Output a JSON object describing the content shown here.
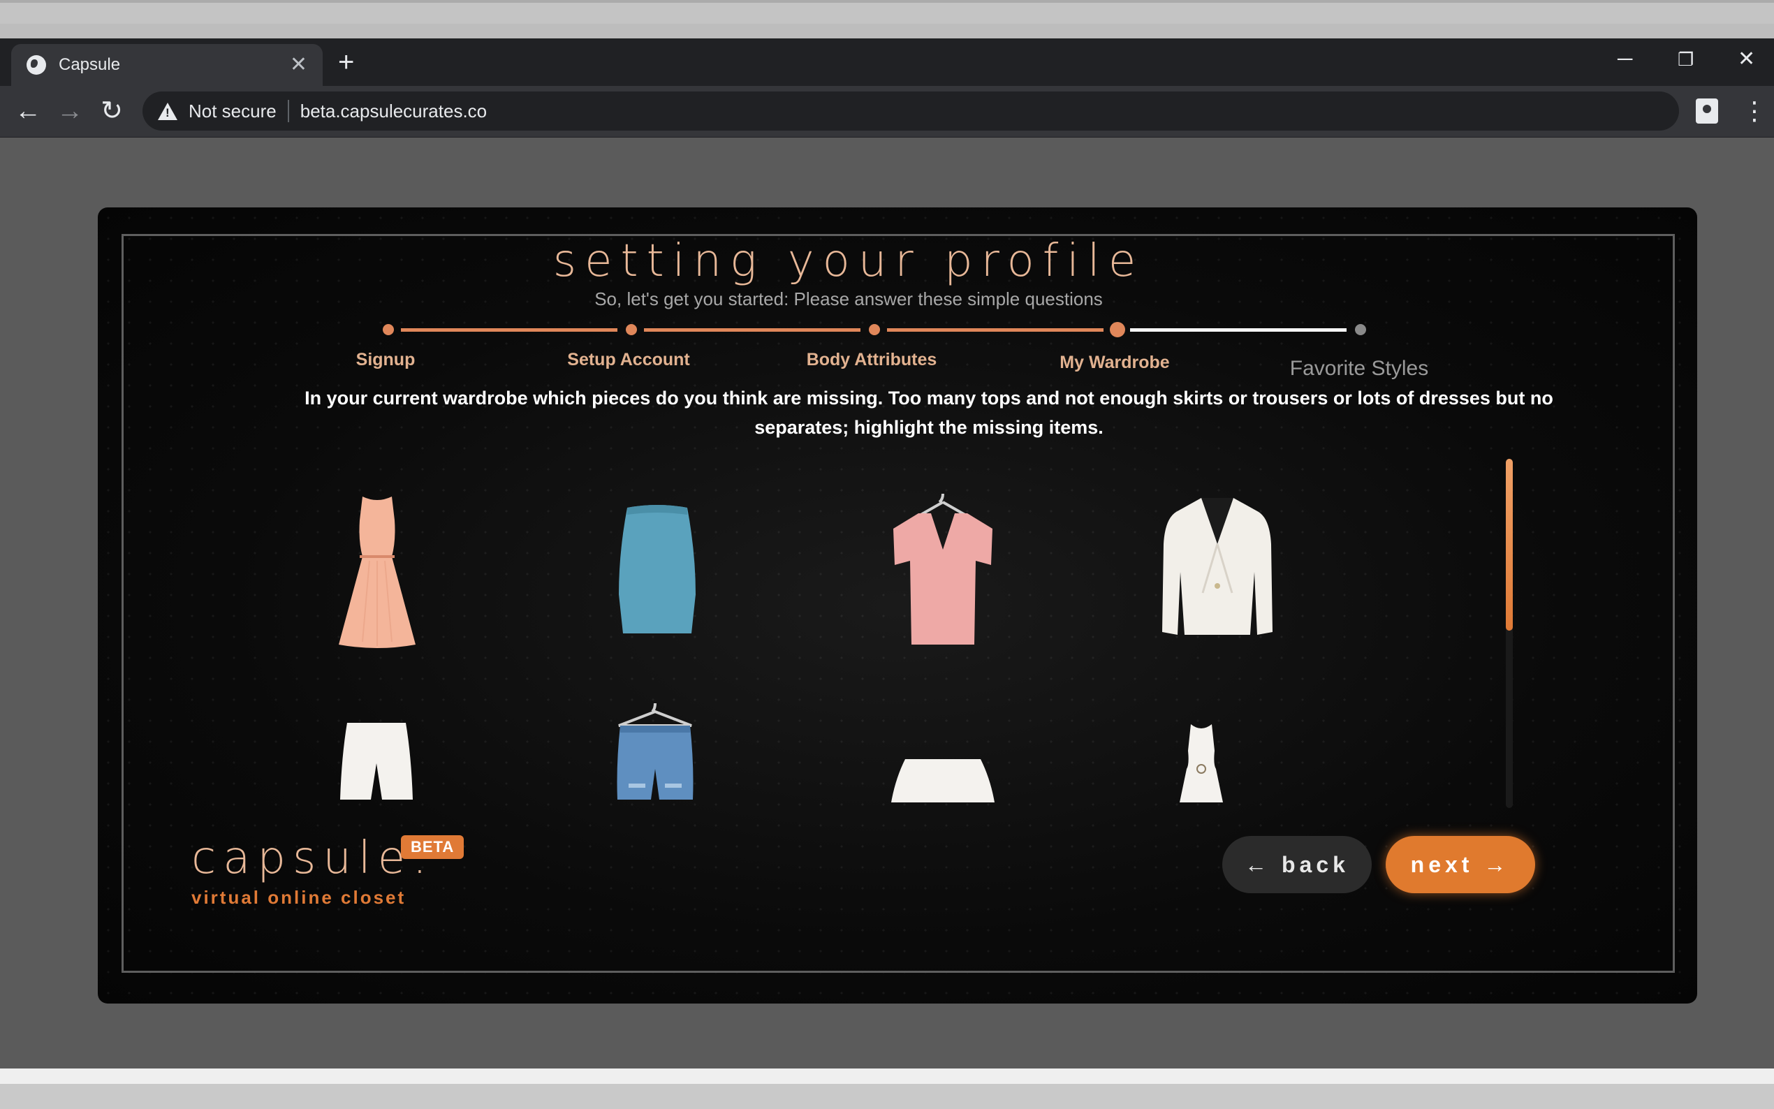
{
  "browser": {
    "tab_title": "Capsule",
    "tab_close": "✕",
    "new_tab": "+",
    "minimize": "─",
    "restore": "❐",
    "close": "✕",
    "back": "←",
    "forward": "→",
    "reload": "↻",
    "security_text": "Not secure",
    "url": "beta.capsulecurates.co",
    "menu": "⋮"
  },
  "page": {
    "title": "setting your profile",
    "subtitle": "So, let's get you started: Please answer these simple questions",
    "steps": [
      {
        "label": "Signup",
        "state": "done"
      },
      {
        "label": "Setup Account",
        "state": "done"
      },
      {
        "label": "Body Attributes",
        "state": "done"
      },
      {
        "label": "My Wardrobe",
        "state": "current"
      },
      {
        "label": "Favorite Styles",
        "state": "pending"
      }
    ],
    "question": "In your current wardrobe which pieces do you think are missing. Too many tops and not enough skirts or trousers or lots of dresses but no separates; highlight the missing items.",
    "items": [
      {
        "name": "peach-dress",
        "color": "#f4b59a"
      },
      {
        "name": "blue-pencil-skirt",
        "color": "#5aa2bd"
      },
      {
        "name": "pink-v-neck-top",
        "color": "#eea9a6"
      },
      {
        "name": "white-blazer",
        "color": "#f2efe9"
      },
      {
        "name": "white-shorts",
        "color": "#f4f2ee"
      },
      {
        "name": "denim-shorts",
        "color": "#5f8fc0"
      },
      {
        "name": "white-skirt",
        "color": "#f4f2ee"
      },
      {
        "name": "white-mini-dress",
        "color": "#f4f2ee"
      }
    ],
    "scroll_fraction": 0.3,
    "logo": {
      "text": "capsule:",
      "badge": "BETA",
      "tagline": "virtual online closet"
    },
    "back_label": "← back",
    "next_label": "next →",
    "accent_color": "#e07a36"
  }
}
